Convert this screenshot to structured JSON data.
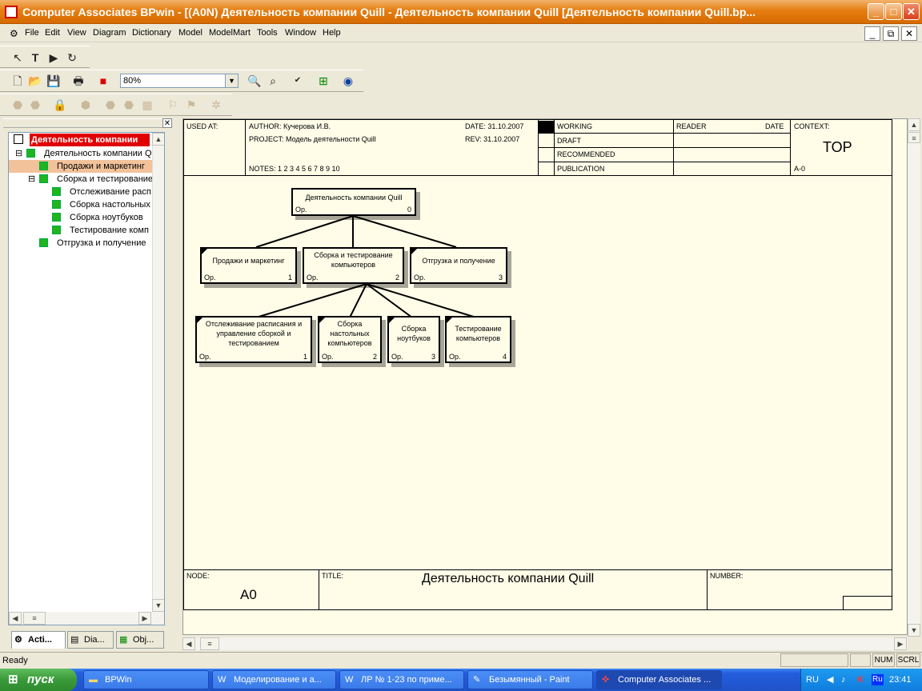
{
  "window": {
    "title": "Computer Associates BPwin - [(A0N) Деятельность компании Quill - Деятельность компании Quill  [Деятельность компании Quill.bp..."
  },
  "menu": [
    "File",
    "Edit",
    "View",
    "Diagram",
    "Dictionary",
    "Model",
    "ModelMart",
    "Tools",
    "Window",
    "Help"
  ],
  "toolbar": {
    "zoom": "80%"
  },
  "tree": {
    "root": "Деятельность компании",
    "items": [
      {
        "label": "Деятельность компании Q"
      },
      {
        "label": "Продажи и маркетинг"
      },
      {
        "label": "Сборка и тестирование"
      },
      {
        "label": "Отслеживание расп"
      },
      {
        "label": "Сборка настольных"
      },
      {
        "label": "Сборка ноутбуков"
      },
      {
        "label": "Тестирование комп"
      },
      {
        "label": "Отгрузка и получение"
      }
    ]
  },
  "tabs": [
    "Acti...",
    "Dia...",
    "Obj..."
  ],
  "header": {
    "used_at": "USED AT:",
    "author": "AUTHOR:  Кучерова И.В.",
    "project": "PROJECT:  Модель деятельности Quill",
    "notes": "NOTES:  1  2  3  4  5  6  7  8  9  10",
    "date": "DATE:  31.10.2007",
    "rev": "REV:    31.10.2007",
    "working": "WORKING",
    "draft": "DRAFT",
    "recommended": "RECOMMENDED",
    "publication": "PUBLICATION",
    "reader": "READER",
    "date2": "DATE",
    "context": "CONTEXT:",
    "top": "TOP",
    "a0": "A-0"
  },
  "boxes": {
    "root": {
      "title": "Деятельность компании Quill",
      "op": "Op.",
      "num": "0"
    },
    "b1": {
      "title": "Продажи и маркетинг",
      "op": "Op.",
      "num": "1"
    },
    "b2": {
      "title": "Сборка и тестирование компьютеров",
      "op": "Op.",
      "num": "2"
    },
    "b3": {
      "title": "Отгрузка и получение",
      "op": "Op.",
      "num": "3"
    },
    "c1": {
      "title": "Отслеживание расписания и управление сборкой и тестированием",
      "op": "Op.",
      "num": "1"
    },
    "c2": {
      "title": "Сборка настольных компьютеров",
      "op": "Op.",
      "num": "2"
    },
    "c3": {
      "title": "Сборка ноутбуков",
      "op": "Op.",
      "num": "3"
    },
    "c4": {
      "title": "Тестирование компьютеров",
      "op": "Op.",
      "num": "4"
    }
  },
  "footer": {
    "node_label": "NODE:",
    "node": "A0",
    "title_label": "TITLE:",
    "title": "Деятельность компании Quill",
    "number_label": "NUMBER:"
  },
  "status": {
    "text": "Ready",
    "num": "NUM",
    "scrl": "SCRL"
  },
  "taskbar": {
    "start": "пуск",
    "tasks": [
      "BPWin",
      "Моделирование и а...",
      "ЛР № 1-23 по приме...",
      "Безымянный - Paint",
      "Computer Associates ..."
    ],
    "lang": "RU",
    "lang2": "Ru",
    "clock": "23:41"
  }
}
